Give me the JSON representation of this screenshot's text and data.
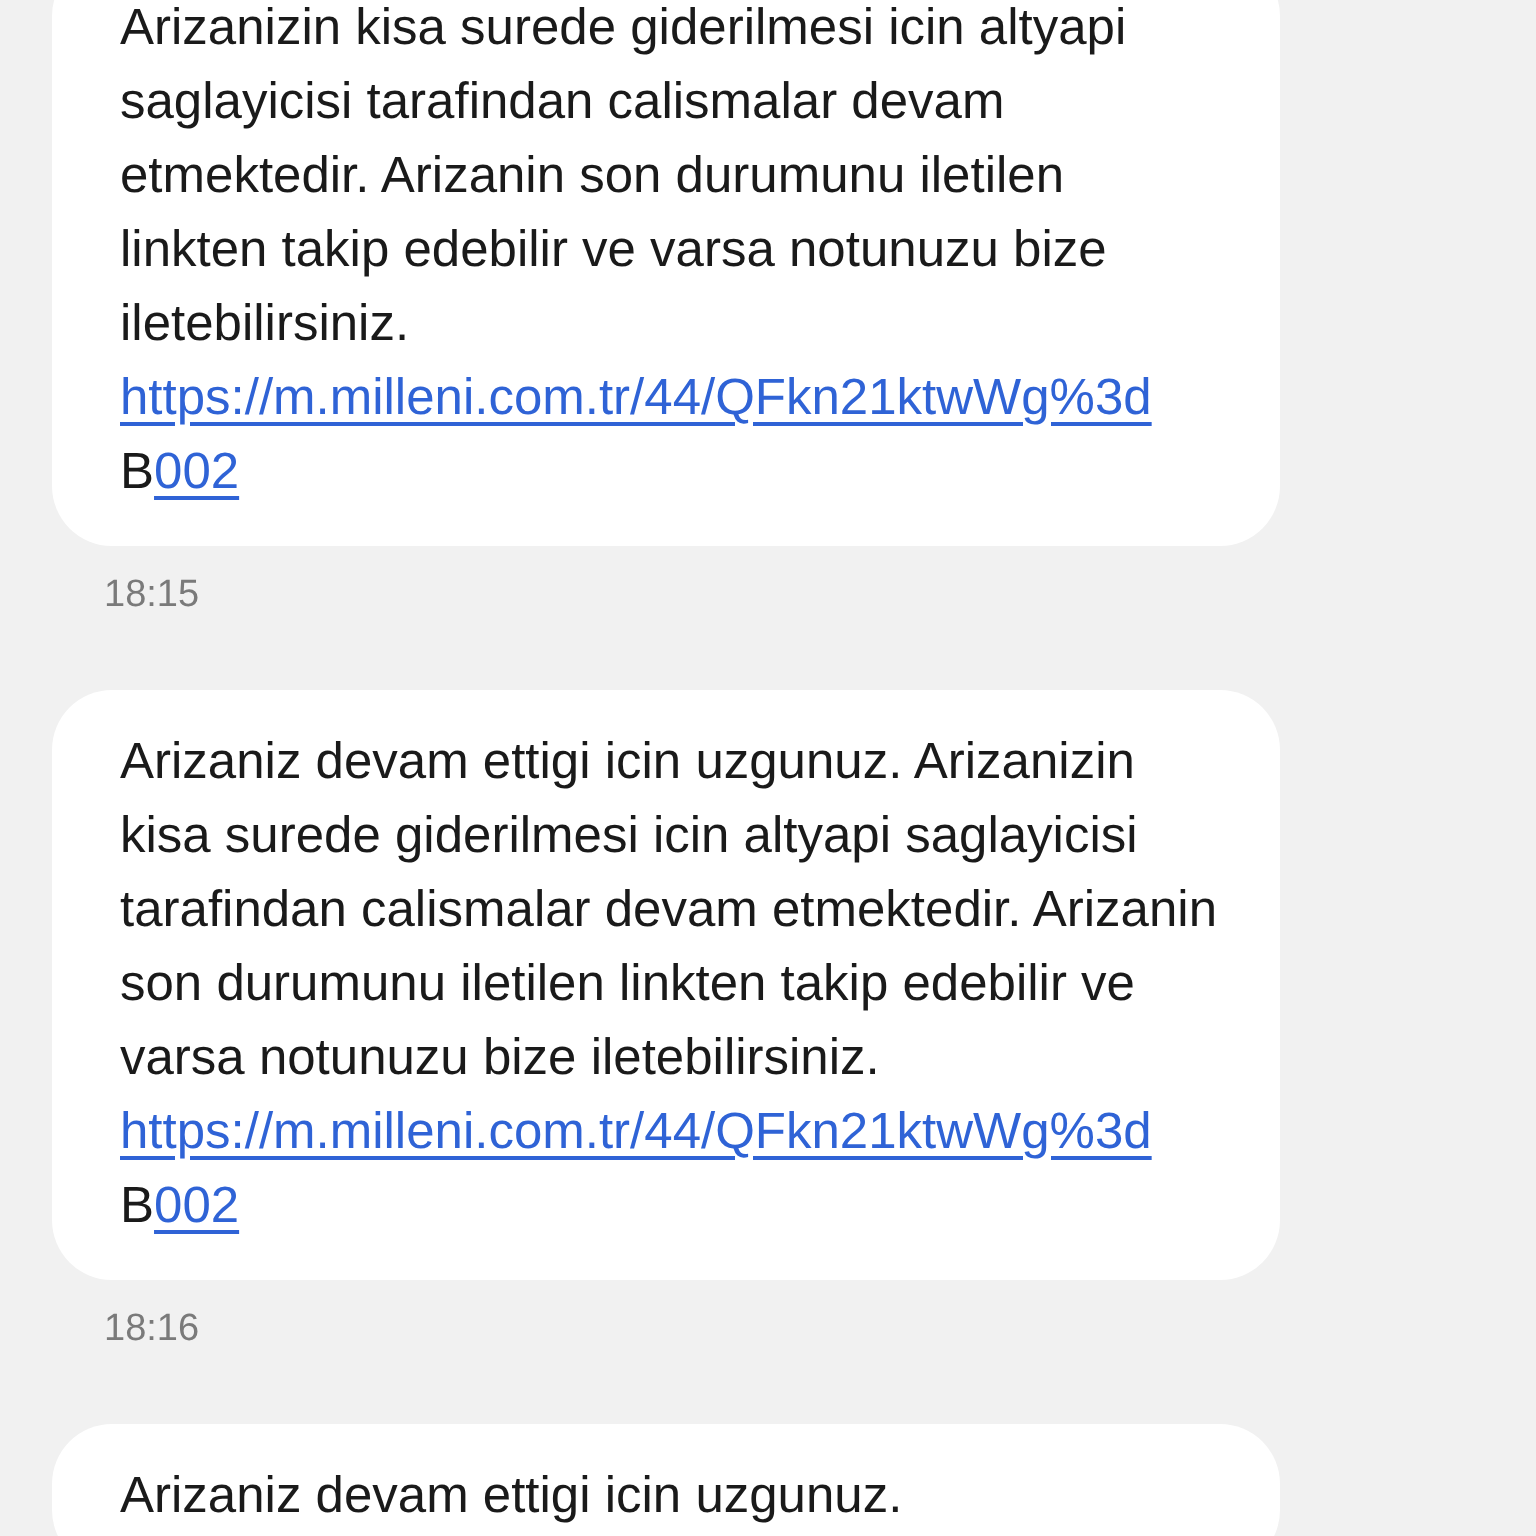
{
  "messages": [
    {
      "parts": [
        {
          "kind": "text",
          "text": "Arizanizin kisa surede giderilmesi icin altyapi saglayicisi tarafindan calismalar devam etmektedir. Arizanin son durumunu iletilen linkten takip edebilir ve varsa notunuzu bize iletebilirsiniz. "
        },
        {
          "kind": "link",
          "text": "https://m.milleni.com.tr/44/QFkn21ktwWg%3d"
        },
        {
          "kind": "text",
          "text": " B"
        },
        {
          "kind": "link",
          "text": "002"
        }
      ],
      "time": "18:15"
    },
    {
      "parts": [
        {
          "kind": "text",
          "text": "Arizaniz devam ettigi icin uzgunuz. Arizanizin kisa surede giderilmesi icin altyapi saglayicisi tarafindan calismalar devam etmektedir. Arizanin son durumunu iletilen linkten takip edebilir ve varsa notunuzu bize iletebilirsiniz. "
        },
        {
          "kind": "link",
          "text": "https://m.milleni.com.tr/44/QFkn21ktwWg%3d"
        },
        {
          "kind": "text",
          "text": " B"
        },
        {
          "kind": "link",
          "text": "002"
        }
      ],
      "time": "18:16"
    },
    {
      "parts": [
        {
          "kind": "text",
          "text": "Arizaniz devam ettigi icin uzgunuz."
        }
      ]
    }
  ]
}
